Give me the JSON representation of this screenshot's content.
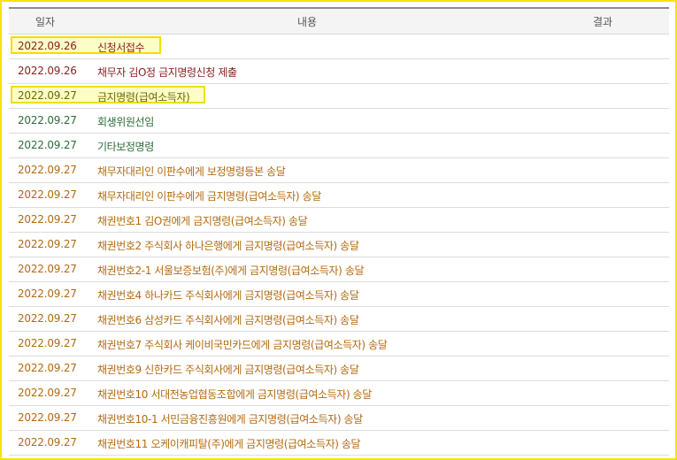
{
  "header": {
    "date": "일자",
    "content": "내용",
    "result": "결과"
  },
  "rows": [
    {
      "date": "2022.09.26",
      "desc": "신청서접수"
    },
    {
      "date": "2022.09.26",
      "desc": "채무자 김O정 금지명령신청 제출"
    },
    {
      "date": "2022.09.27",
      "desc": "금지명령(급여소득자)"
    },
    {
      "date": "2022.09.27",
      "desc": "회생위원선임"
    },
    {
      "date": "2022.09.27",
      "desc": "기타보정명령"
    },
    {
      "date": "2022.09.27",
      "desc": "채무자대리인 이판수에게 보정명령등본 송달"
    },
    {
      "date": "2022.09.27",
      "desc": "채무자대리인 이판수에게 금지명령(급여소득자) 송달"
    },
    {
      "date": "2022.09.27",
      "desc": "채권번호1 김O권에게 금지명령(급여소득자) 송달"
    },
    {
      "date": "2022.09.27",
      "desc": "채권번호2 주식회사 하나은행에게 금지명령(급여소득자) 송달"
    },
    {
      "date": "2022.09.27",
      "desc": "채권번호2-1 서울보증보험(주)에게 금지명령(급여소득자) 송달"
    },
    {
      "date": "2022.09.27",
      "desc": "채권번호4 하나카드 주식회사에게 금지명령(급여소득자) 송달"
    },
    {
      "date": "2022.09.27",
      "desc": "채권번호6 삼성카드 주식회사에게 금지명령(급여소득자) 송달"
    },
    {
      "date": "2022.09.27",
      "desc": "채권번호7 주식회사 케이비국민카드에게 금지명령(급여소득자) 송달"
    },
    {
      "date": "2022.09.27",
      "desc": "채권번호9 신한카드 주식회사에게 금지명령(급여소득자) 송달"
    },
    {
      "date": "2022.09.27",
      "desc": "채권번호10 서대전농업협동조합에게 금지명령(급여소득자) 송달"
    },
    {
      "date": "2022.09.27",
      "desc": "채권번호10-1 서민금융진흥원에게 금지명령(급여소득자) 송달"
    },
    {
      "date": "2022.09.27",
      "desc": "채권번호11 오케이캐피탈(주)에게 금지명령(급여소득자) 송달"
    }
  ],
  "colors": {
    "highlight_border": "#f0df00",
    "highlight_fill": "#fdfdc8",
    "frame": "#f5e400"
  }
}
